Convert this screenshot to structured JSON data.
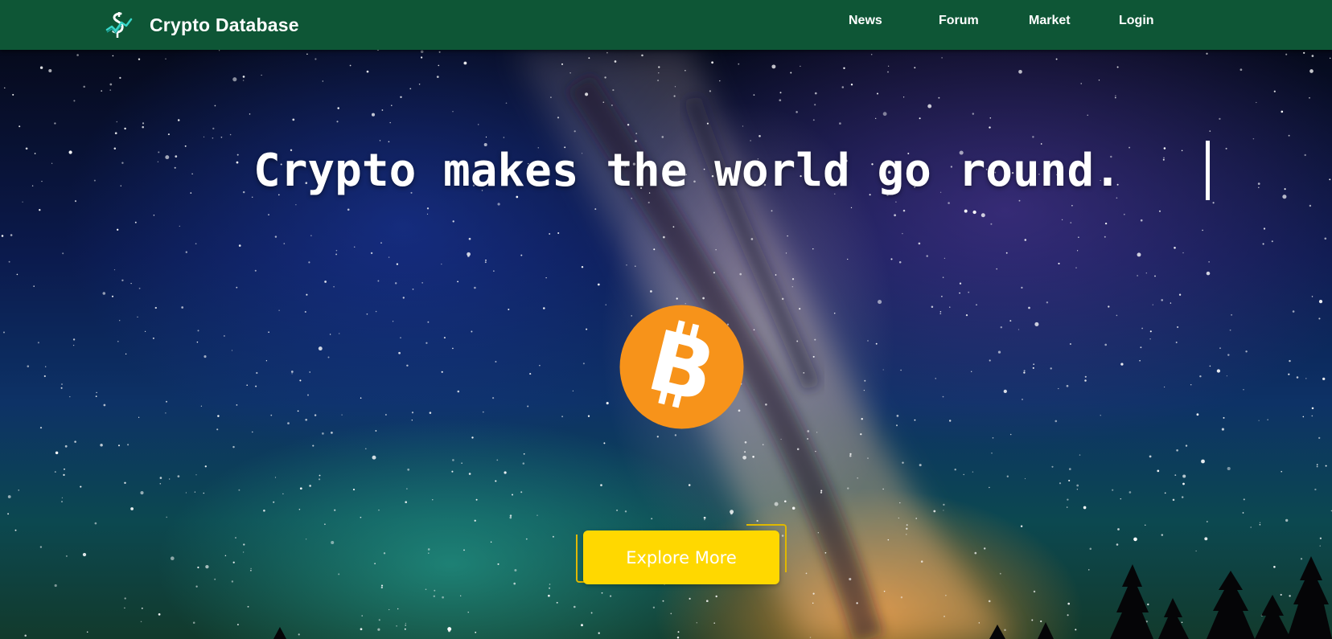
{
  "navbar": {
    "brand_title": "Crypto Database",
    "brand_logo_icon": "dollar-chart-logo-icon",
    "links": [
      {
        "label": "News"
      },
      {
        "label": "Forum"
      },
      {
        "label": "Market"
      },
      {
        "label": "Login"
      }
    ],
    "background_color": "#0e5636"
  },
  "hero": {
    "headline": "Crypto makes the world go round.",
    "coin_icon": "bitcoin-icon",
    "coin_color": "#f7931a",
    "cta_label": "Explore More",
    "cta_color": "#ffd800"
  }
}
